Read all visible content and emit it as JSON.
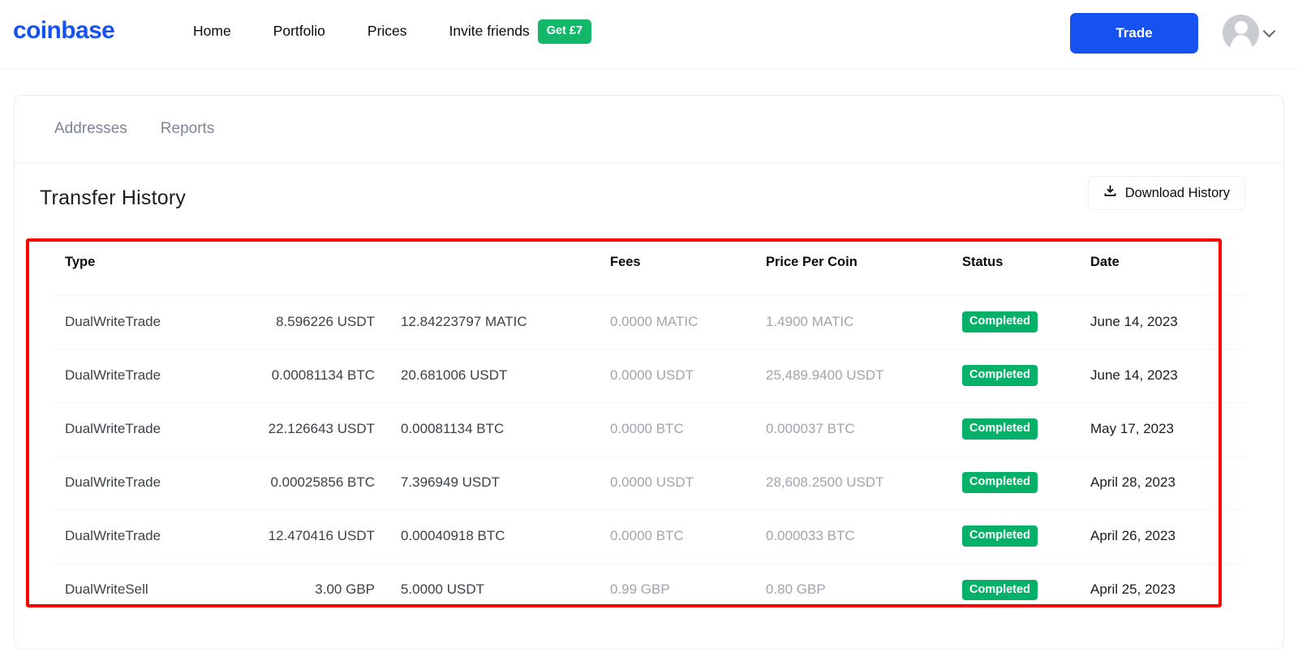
{
  "header": {
    "logo": "coinbase",
    "nav": [
      {
        "label": "Home"
      },
      {
        "label": "Portfolio"
      },
      {
        "label": "Prices"
      },
      {
        "label": "Invite friends"
      }
    ],
    "invite_badge": "Get £7",
    "trade_button": "Trade",
    "avatar_icon": "user-avatar-icon",
    "chevron_icon": "chevron-down-icon",
    "colors": {
      "brand_blue": "#1652F0",
      "badge_green": "#12B76A"
    }
  },
  "card": {
    "tabs": [
      {
        "label": "Addresses"
      },
      {
        "label": "Reports"
      }
    ],
    "section_title": "Transfer History",
    "download_button": {
      "label": "Download History",
      "icon": "download-icon"
    }
  },
  "table": {
    "columns": [
      {
        "key": "type",
        "label": "Type"
      },
      {
        "key": "amount_sent",
        "label": ""
      },
      {
        "key": "amount_received",
        "label": ""
      },
      {
        "key": "fees",
        "label": "Fees"
      },
      {
        "key": "price_per_coin",
        "label": "Price Per Coin"
      },
      {
        "key": "status",
        "label": "Status"
      },
      {
        "key": "date",
        "label": "Date"
      }
    ],
    "rows": [
      {
        "type": "DualWriteTrade",
        "amount_sent": "8.596226 USDT",
        "amount_received": "12.84223797 MATIC",
        "fees": "0.0000 MATIC",
        "price_per_coin": "1.4900 MATIC",
        "status": "Completed",
        "date": "June 14, 2023"
      },
      {
        "type": "DualWriteTrade",
        "amount_sent": "0.00081134 BTC",
        "amount_received": "20.681006 USDT",
        "fees": "0.0000 USDT",
        "price_per_coin": "25,489.9400 USDT",
        "status": "Completed",
        "date": "June 14, 2023"
      },
      {
        "type": "DualWriteTrade",
        "amount_sent": "22.126643 USDT",
        "amount_received": "0.00081134 BTC",
        "fees": "0.0000 BTC",
        "price_per_coin": "0.000037 BTC",
        "status": "Completed",
        "date": "May 17, 2023"
      },
      {
        "type": "DualWriteTrade",
        "amount_sent": "0.00025856 BTC",
        "amount_received": "7.396949 USDT",
        "fees": "0.0000 USDT",
        "price_per_coin": "28,608.2500 USDT",
        "status": "Completed",
        "date": "April 28, 2023"
      },
      {
        "type": "DualWriteTrade",
        "amount_sent": "12.470416 USDT",
        "amount_received": "0.00040918 BTC",
        "fees": "0.0000 BTC",
        "price_per_coin": "0.000033 BTC",
        "status": "Completed",
        "date": "April 26, 2023"
      },
      {
        "type": "DualWriteSell",
        "amount_sent": "3.00 GBP",
        "amount_received": "5.0000 USDT",
        "fees": "0.99 GBP",
        "price_per_coin": "0.80 GBP",
        "status": "Completed",
        "date": "April 25, 2023"
      }
    ],
    "status_badge_color": "#05B169",
    "annotation_highlight_color": "#FF0000"
  }
}
